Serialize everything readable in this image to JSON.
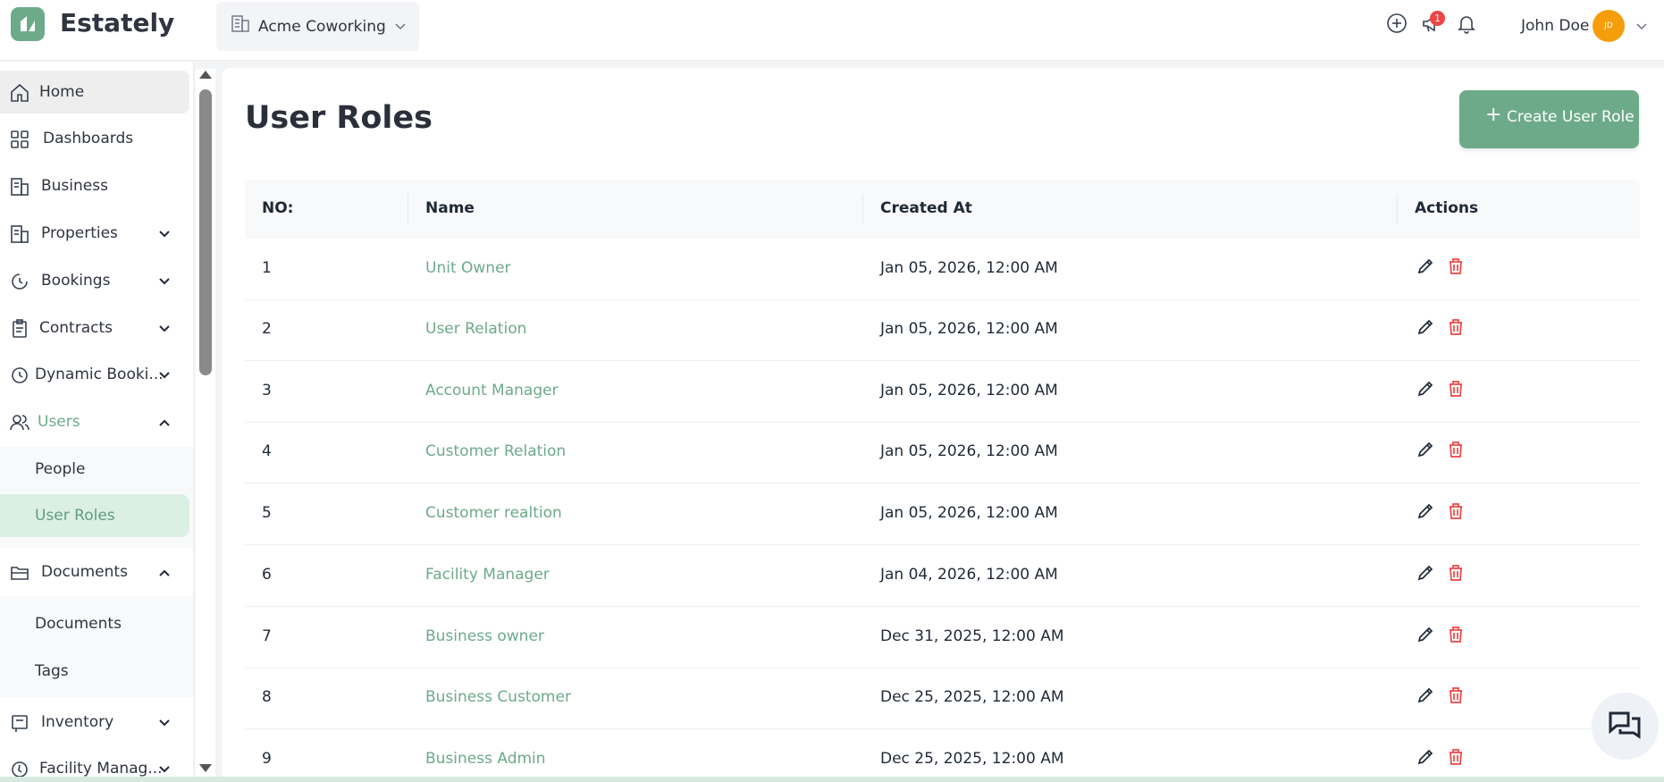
{
  "app": {
    "brand": "Estately"
  },
  "header": {
    "workspace": "Acme Coworking",
    "notification_badge": "1",
    "user_name": "John Doe",
    "avatar_initials": "JD"
  },
  "sidebar": {
    "items": [
      {
        "label": "Home",
        "icon": "home-icon"
      },
      {
        "label": "Dashboards",
        "icon": "grid-icon"
      },
      {
        "label": "Business",
        "icon": "building-icon"
      },
      {
        "label": "Properties",
        "icon": "building-icon"
      },
      {
        "label": "Bookings",
        "icon": "clock-icon"
      },
      {
        "label": "Contracts",
        "icon": "contract-icon"
      },
      {
        "label": "Dynamic Booki...",
        "icon": "clock-icon"
      },
      {
        "label": "Users",
        "icon": "users-icon"
      },
      {
        "label": "Documents",
        "icon": "folder-icon"
      },
      {
        "label": "Inventory",
        "icon": "inventory-icon"
      },
      {
        "label": "Facility Manag...",
        "icon": "facility-icon"
      }
    ],
    "users_sub": [
      {
        "label": "People"
      },
      {
        "label": "User Roles"
      }
    ],
    "documents_sub": [
      {
        "label": "Documents"
      },
      {
        "label": "Tags"
      }
    ]
  },
  "main": {
    "title": "User Roles",
    "create_button": "Create User Role",
    "columns": [
      "NO:",
      "Name",
      "Created At",
      "Actions"
    ],
    "rows": [
      {
        "no": "1",
        "name": "Unit Owner",
        "created": "Jan 05, 2026, 12:00 AM"
      },
      {
        "no": "2",
        "name": "User Relation",
        "created": "Jan 05, 2026, 12:00 AM"
      },
      {
        "no": "3",
        "name": "Account Manager",
        "created": "Jan 05, 2026, 12:00 AM"
      },
      {
        "no": "4",
        "name": "Customer Relation",
        "created": "Jan 05, 2026, 12:00 AM"
      },
      {
        "no": "5",
        "name": "Customer realtion",
        "created": "Jan 05, 2026, 12:00 AM"
      },
      {
        "no": "6",
        "name": "Facility Manager",
        "created": "Jan 04, 2026, 12:00 AM"
      },
      {
        "no": "7",
        "name": "Business owner",
        "created": "Dec 31, 2025, 12:00 AM"
      },
      {
        "no": "8",
        "name": "Business Customer",
        "created": "Dec 25, 2025, 12:00 AM"
      },
      {
        "no": "9",
        "name": "Business Admin",
        "created": "Dec 25, 2025, 12:00 AM"
      }
    ]
  },
  "colors": {
    "accent": "#6daa8a",
    "danger": "#ef4444",
    "avatar": "#f59e0b"
  }
}
